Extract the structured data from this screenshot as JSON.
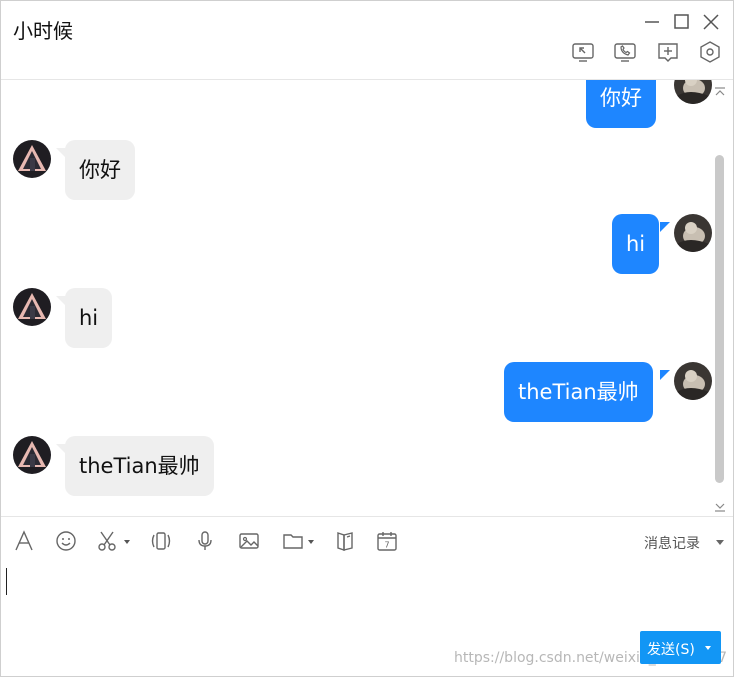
{
  "window": {
    "title": "小时候"
  },
  "toolbar": {
    "history_label": "消息记录"
  },
  "messages": [
    {
      "side": "right",
      "text": "你好"
    },
    {
      "side": "left",
      "text": "你好"
    },
    {
      "side": "right",
      "text": "hi"
    },
    {
      "side": "left",
      "text": "hi"
    },
    {
      "side": "right",
      "text": "theTian最帅"
    },
    {
      "side": "left",
      "text": "theTian最帅"
    }
  ],
  "input": {
    "send_label": "发送(S)"
  },
  "watermark": "https://blog.csdn.net/weixin_43544077",
  "colors": {
    "my_bubble": "#1e86ff",
    "their_bubble": "#efefef",
    "send_button": "#1296f5"
  },
  "icons": {
    "window_controls": [
      "minimize-icon",
      "maximize-icon",
      "close-icon"
    ],
    "header_tools": [
      "screen-share-icon",
      "phone-call-icon",
      "add-chat-icon",
      "settings-hex-icon"
    ],
    "toolbar": [
      "font-icon",
      "emoji-icon",
      "scissors-icon",
      "shake-icon",
      "microphone-icon",
      "image-icon",
      "folder-icon",
      "gift-icon",
      "calendar-icon"
    ]
  }
}
